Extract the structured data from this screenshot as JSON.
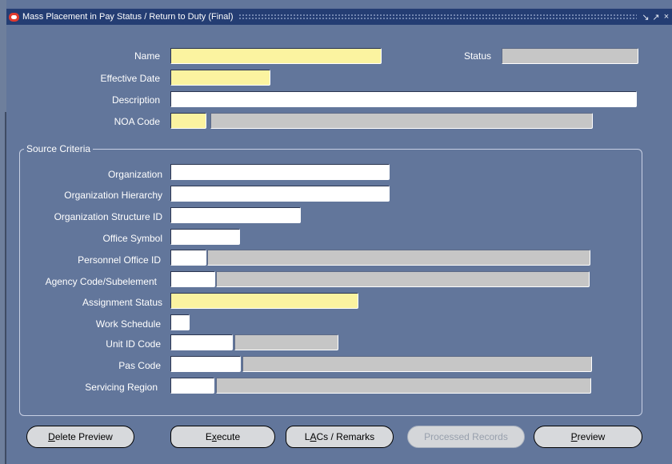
{
  "window": {
    "title": "Mass Placement in Pay Status / Return to Duty (Final)",
    "controls": [
      "minimize",
      "maximize",
      "close"
    ]
  },
  "header": {
    "name_label": "Name",
    "name_value": "",
    "status_label": "Status",
    "status_value": "",
    "effective_date_label": "Effective Date",
    "effective_date_value": "",
    "description_label": "Description",
    "description_value": "",
    "noa_code_label": "NOA Code",
    "noa_code_value": "",
    "noa_desc_value": ""
  },
  "source_criteria": {
    "group_label": "Source Criteria",
    "organization_label": "Organization",
    "organization_hierarchy_label": "Organization Hierarchy",
    "organization_structure_id_label": "Organization Structure ID",
    "office_symbol_label": "Office Symbol",
    "personnel_office_id_label": "Personnel Office ID",
    "agency_code_label": "Agency Code/Subelement",
    "assignment_status_label": "Assignment Status",
    "work_schedule_label": "Work Schedule",
    "unit_id_code_label": "Unit ID Code",
    "pas_code_label": "Pas Code",
    "servicing_region_label": "Servicing Region"
  },
  "buttons": {
    "delete_preview": {
      "pre": "",
      "accel": "D",
      "post": "elete Preview"
    },
    "execute": {
      "pre": "E",
      "accel": "x",
      "post": "ecute"
    },
    "lacs_remarks": {
      "pre": "L",
      "accel": "A",
      "post": "Cs / Remarks"
    },
    "processed_records": "Processed Records",
    "preview": {
      "pre": "",
      "accel": "P",
      "post": "review"
    }
  },
  "colors": {
    "background": "#62769b",
    "titlebar": "#243d73",
    "required_field": "#fbf3a0",
    "readonly_field": "#c6c6c6"
  }
}
